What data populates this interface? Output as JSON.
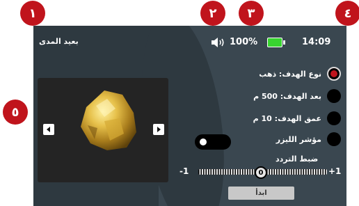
{
  "badges": [
    "١",
    "٢",
    "٣",
    "٤",
    "٥"
  ],
  "header": {
    "mode_label": "بعيد المدى",
    "volume_icon": "speaker-icon",
    "battery_percent": "100%",
    "battery_color": "#38d430",
    "time": "14:09"
  },
  "options": [
    {
      "label": "نوع الهدف: ذهب",
      "selected": true
    },
    {
      "label": "بعد الهدف: 500 م",
      "selected": false
    },
    {
      "label": "عمق الهدف: 10 م",
      "selected": false
    },
    {
      "label": "مؤشر الليزر",
      "selected": false
    }
  ],
  "laser_toggle": {
    "on": false
  },
  "frequency": {
    "title": "ضبط التردد",
    "min_label": "-1",
    "max_label": "+1",
    "value": "0"
  },
  "start_button": "ابدأ",
  "viewer": {
    "prev_icon": "left-arrow-icon",
    "next_icon": "right-arrow-icon",
    "image": "gold-nugget"
  },
  "colors": {
    "badge": "#c0141c",
    "screen": "#3a4750",
    "selected_radio": "#c0141c"
  }
}
